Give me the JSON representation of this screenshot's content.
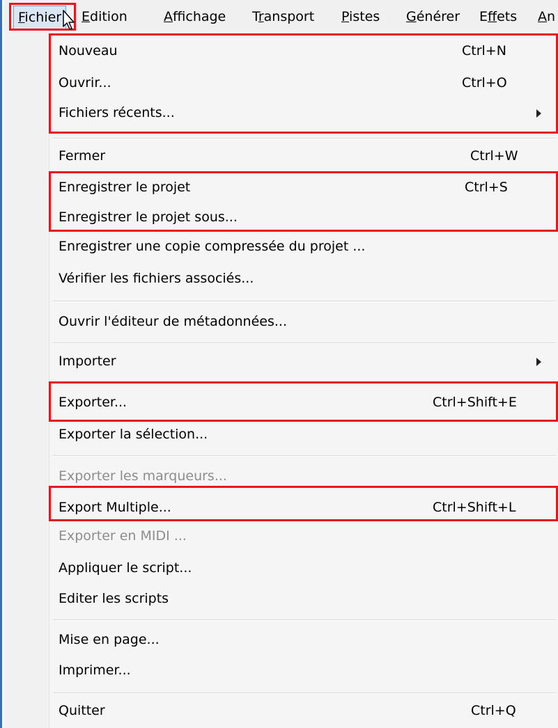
{
  "menubar": {
    "items": [
      {
        "label": "Fichier",
        "ul_index": 0
      },
      {
        "label": "Edition",
        "ul_index": 0
      },
      {
        "label": "Affichage",
        "ul_index": 0
      },
      {
        "label": "Transport",
        "ul_index": 1
      },
      {
        "label": "Pistes",
        "ul_index": 0
      },
      {
        "label": "Générer",
        "ul_index": 0
      },
      {
        "label": "Effets",
        "ul_index": 1
      },
      {
        "label": "An",
        "ul_index": 0
      }
    ]
  },
  "menu": {
    "items": [
      {
        "label": "Nouveau",
        "shortcut": "Ctrl+N"
      },
      {
        "label": "Ouvrir...",
        "shortcut": "Ctrl+O"
      },
      {
        "label": "Fichiers récents...",
        "shortcut": ""
      },
      {
        "label": "Fermer",
        "shortcut": "Ctrl+W"
      },
      {
        "label": "Enregistrer le projet",
        "shortcut": "Ctrl+S"
      },
      {
        "label": "Enregistrer le projet sous...",
        "shortcut": ""
      },
      {
        "label": "Enregistrer une copie compressée du projet ...",
        "shortcut": ""
      },
      {
        "label": "Vérifier les fichiers associés...",
        "shortcut": ""
      },
      {
        "label": "Ouvrir l'éditeur de métadonnées...",
        "shortcut": ""
      },
      {
        "label": "Importer",
        "shortcut": ""
      },
      {
        "label": "Exporter...",
        "shortcut": "Ctrl+Shift+E"
      },
      {
        "label": "Exporter la sélection...",
        "shortcut": ""
      },
      {
        "label": "Exporter les marqueurs...",
        "shortcut": "",
        "disabled": true
      },
      {
        "label": "Export Multiple...",
        "shortcut": "Ctrl+Shift+L"
      },
      {
        "label": "Exporter en MIDI ...",
        "shortcut": "",
        "disabled": true
      },
      {
        "label": "Appliquer le script...",
        "shortcut": ""
      },
      {
        "label": "Editer les scripts",
        "shortcut": ""
      },
      {
        "label": "Mise en page...",
        "shortcut": ""
      },
      {
        "label": "Imprimer...",
        "shortcut": ""
      },
      {
        "label": "Quitter",
        "shortcut": "Ctrl+Q"
      }
    ]
  },
  "colors": {
    "highlight_box": "#e8141e",
    "disabled_text": "#8d8d8d",
    "menu_background": "#f5f5f5"
  },
  "icons": {
    "submenu": "triangle-right-icon",
    "cursor": "mouse-pointer-icon"
  }
}
